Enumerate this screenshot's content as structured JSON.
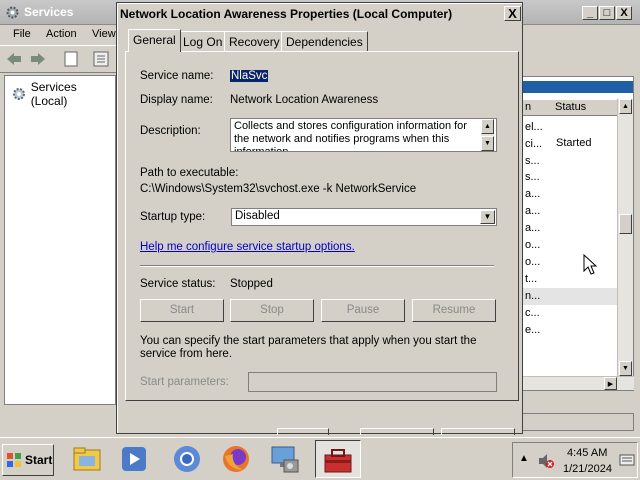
{
  "services_window": {
    "title": "Services",
    "menu": [
      "File",
      "Action",
      "View"
    ],
    "tree_root": "Services (Local)",
    "columns": [
      "n",
      "Status"
    ],
    "row_fragments": [
      "el...",
      "ci...",
      "s...",
      "s...",
      "a...",
      "a...",
      "a...",
      "o...",
      "o...",
      "t...",
      "n...",
      "c...",
      "e..."
    ],
    "row_status": "Started"
  },
  "dialog": {
    "title": "Network Location Awareness Properties (Local Computer)",
    "close_glyph": "X",
    "tabs": [
      "General",
      "Log On",
      "Recovery",
      "Dependencies"
    ],
    "active_tab": "General",
    "service_name_label": "Service name:",
    "service_name": "NlaSvc",
    "display_name_label": "Display name:",
    "display_name": "Network Location Awareness",
    "description_label": "Description:",
    "description": "Collects and stores configuration information for the network and notifies programs when this information",
    "path_label": "Path to executable:",
    "path": "C:\\Windows\\System32\\svchost.exe -k NetworkService",
    "startup_type_label": "Startup type:",
    "startup_type": "Disabled",
    "help_link": "Help me configure service startup options.",
    "service_status_label": "Service status:",
    "service_status": "Stopped",
    "buttons": {
      "start": "Start",
      "stop": "Stop",
      "pause": "Pause",
      "resume": "Resume"
    },
    "params_help": "You can specify the start parameters that apply when you start the service from here.",
    "start_params_label": "Start parameters:",
    "start_params_value": ""
  },
  "taskbar": {
    "start_label": "Start",
    "clock_time": "4:45 AM",
    "clock_date": "1/21/2024"
  },
  "colors": {
    "selection": "#0a246a",
    "link": "#0000cc",
    "list_header_strip": "#1e5fa8",
    "disabled_text": "#8a8a8a"
  }
}
